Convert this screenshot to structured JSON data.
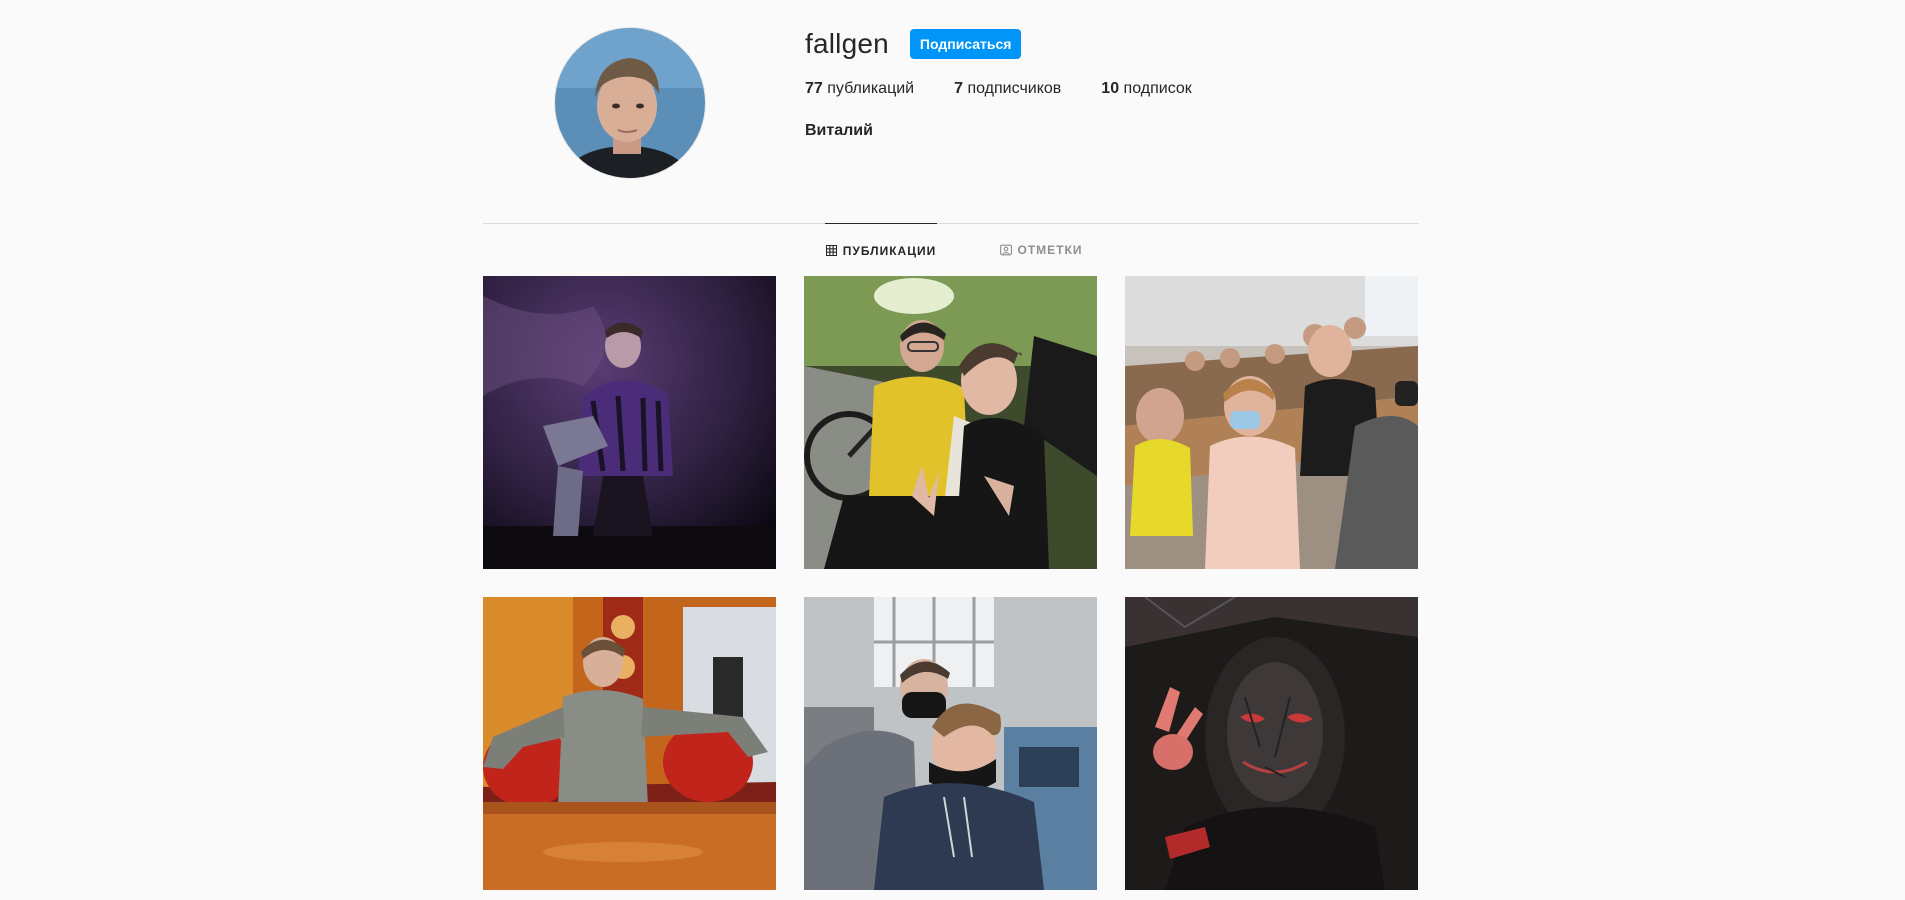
{
  "profile": {
    "username": "fallgen",
    "follow_label": "Подписаться",
    "full_name": "Виталий",
    "stats": [
      {
        "count": "77",
        "label": "публикаций"
      },
      {
        "count": "7",
        "label": "подписчиков"
      },
      {
        "count": "10",
        "label": "подписок"
      }
    ],
    "avatar_icon": "profile-photo"
  },
  "tabs": [
    {
      "label": "ПУБЛИКАЦИИ",
      "icon": "grid-icon",
      "active": true
    },
    {
      "label": "ОТМЕТКИ",
      "icon": "tagged-icon",
      "active": false
    }
  ],
  "posts": [
    {
      "icon": "photo-purple-wall"
    },
    {
      "icon": "photo-bike-selfie"
    },
    {
      "icon": "photo-lecture-hall"
    },
    {
      "icon": "photo-red-sofa"
    },
    {
      "icon": "photo-mask-selfie"
    },
    {
      "icon": "photo-dark-mask"
    }
  ],
  "colors": {
    "accent": "#0095f6",
    "background": "#fafafa",
    "text": "#262626",
    "muted": "#8e8e8e",
    "divider": "#dbdbdb"
  }
}
